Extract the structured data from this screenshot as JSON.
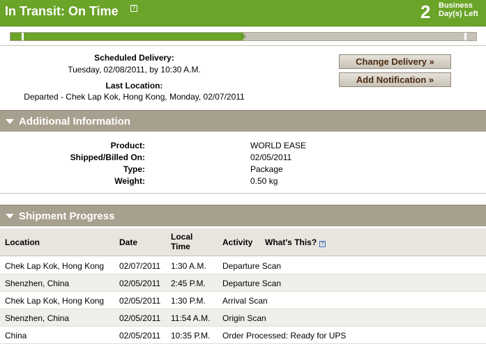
{
  "header": {
    "status": "In Transit: On Time",
    "days_count": "2",
    "days_label_line1": "Business",
    "days_label_line2": "Day(s) Left",
    "help_icon": "question-icon"
  },
  "progress": {
    "fraction": 0.5
  },
  "delivery": {
    "scheduled_label": "Scheduled Delivery:",
    "scheduled_value": "Tuesday, 02/08/2011, by 10:30 A.M.",
    "last_location_label": "Last Location:",
    "last_location_value": "Departed - Chek Lap Kok, Hong Kong, Monday, 02/07/2011",
    "change_delivery_button": "Change Delivery »",
    "add_notification_button": "Add Notification »"
  },
  "additional": {
    "title": "Additional Information",
    "rows": [
      {
        "label": "Product:",
        "value": "WORLD EASE"
      },
      {
        "label": "Shipped/Billed On:",
        "value": "02/05/2011"
      },
      {
        "label": "Type:",
        "value": "Package"
      },
      {
        "label": "Weight:",
        "value": "0.50 kg"
      }
    ]
  },
  "progress_section": {
    "title": "Shipment Progress",
    "columns": {
      "location": "Location",
      "date": "Date",
      "local_time_line1": "Local",
      "local_time_line2": "Time",
      "activity": "Activity",
      "whats_this": "What's This?"
    },
    "rows": [
      {
        "location": "Chek Lap Kok, Hong Kong",
        "date": "02/07/2011",
        "time": "1:30 A.M.",
        "activity": "Departure Scan"
      },
      {
        "location": "Shenzhen, China",
        "date": "02/05/2011",
        "time": "2:45 P.M.",
        "activity": "Departure Scan"
      },
      {
        "location": "Chek Lap Kok, Hong Kong",
        "date": "02/05/2011",
        "time": "1:30 P.M.",
        "activity": "Arrival Scan"
      },
      {
        "location": "Shenzhen, China",
        "date": "02/05/2011",
        "time": "11:54 A.M.",
        "activity": "Origin Scan"
      },
      {
        "location": "China",
        "date": "02/05/2011",
        "time": "10:35 P.M.",
        "activity": "Order Processed: Ready for UPS"
      }
    ]
  },
  "colors": {
    "header_green": "#6aa428",
    "section_bar": "#a8a08e",
    "button_text": "#4a2a10"
  }
}
